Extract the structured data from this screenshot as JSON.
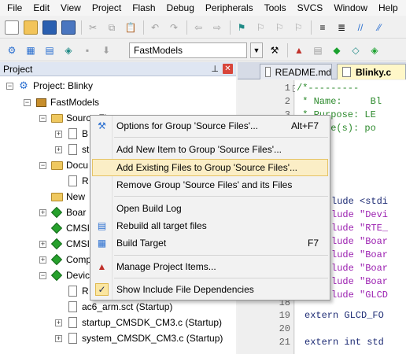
{
  "menu_bar": [
    "File",
    "Edit",
    "View",
    "Project",
    "Flash",
    "Debug",
    "Peripherals",
    "Tools",
    "SVCS",
    "Window",
    "Help"
  ],
  "toolbar": {
    "target_name": "FastModels"
  },
  "project_panel": {
    "title": "Project",
    "pin_glyph": "⊥",
    "close_glyph": "✕",
    "tree": [
      {
        "label": "Project: Blinky",
        "icon": "project-icon",
        "expander": "−"
      },
      {
        "label": "FastModels",
        "icon": "target-icon",
        "expander": "−"
      },
      {
        "label": "Source Fi",
        "icon": "folder-icon",
        "expander": "−"
      },
      {
        "label": "B",
        "icon": "file-icon",
        "expander": "+"
      },
      {
        "label": "st",
        "icon": "file-icon",
        "expander": "+"
      },
      {
        "label": "Docu",
        "icon": "folder-icon",
        "expander": "−"
      },
      {
        "label": "R",
        "icon": "file-icon",
        "expander": ""
      },
      {
        "label": "New",
        "icon": "folder-icon",
        "expander": ""
      },
      {
        "label": "Boar",
        "icon": "component-icon",
        "expander": "+"
      },
      {
        "label": "CMSI",
        "icon": "component-icon",
        "expander": ""
      },
      {
        "label": "CMSI",
        "icon": "component-icon",
        "expander": "+"
      },
      {
        "label": "Comp",
        "icon": "component-icon",
        "expander": "+"
      },
      {
        "label": "Devic",
        "icon": "component-icon",
        "expander": "−"
      },
      {
        "label": "R",
        "icon": "file-icon",
        "expander": ""
      },
      {
        "label": "ac6_arm.sct (Startup)",
        "icon": "file-icon",
        "expander": ""
      },
      {
        "label": "startup_CMSDK_CM3.c (Startup)",
        "icon": "file-icon",
        "expander": "+"
      },
      {
        "label": "system_CMSDK_CM3.c (Startup)",
        "icon": "file-icon",
        "expander": "+"
      }
    ]
  },
  "editor": {
    "tabs": [
      {
        "label": "README.md",
        "active": false
      },
      {
        "label": "Blinky.c",
        "active": true
      }
    ],
    "line_numbers": [
      "1",
      "2",
      "3",
      "18",
      "19",
      "20",
      "21"
    ],
    "code_lines": [
      "/*---------",
      " * Name:     Bl",
      " * Purpose: LE",
      " * Note(s): po",
      "",
      "          ",
      "",
      "",
      "lude <stdi",
      "lude \"Devi",
      "lude \"RTE_",
      "lude \"Boar",
      "lude \"Boar",
      "lude \"Boar",
      "lude \"Boar",
      "lude \"GLCD",
      "",
      "extern GLCD_FO",
      "",
      "extern int std"
    ]
  },
  "context_menu": {
    "items": [
      {
        "label": "Options for Group 'Source Files'...",
        "shortcut": "Alt+F7",
        "icon": "options-icon"
      },
      {
        "label": "Add New  Item to Group 'Source Files'...",
        "shortcut": "",
        "icon": ""
      },
      {
        "label": "Add Existing Files to Group 'Source Files'...",
        "shortcut": "",
        "icon": ""
      },
      {
        "label": "Remove Group 'Source Files' and its Files",
        "shortcut": "",
        "icon": ""
      },
      {
        "label": "Open Build Log",
        "shortcut": "",
        "icon": ""
      },
      {
        "label": "Rebuild all target files",
        "shortcut": "",
        "icon": "rebuild-icon"
      },
      {
        "label": "Build Target",
        "shortcut": "F7",
        "icon": "build-icon"
      },
      {
        "label": "Manage Project Items...",
        "shortcut": "",
        "icon": "manage-items-icon"
      },
      {
        "label": "Show Include File Dependencies",
        "shortcut": "",
        "icon": "checkmark-icon",
        "checked": true
      }
    ],
    "highlighted_index": 2
  },
  "colors": {
    "menu_highlight": "#fbeec6",
    "active_tab": "#fff7c8",
    "comment": "#2d8a2d",
    "string": "#9b1fb0"
  }
}
